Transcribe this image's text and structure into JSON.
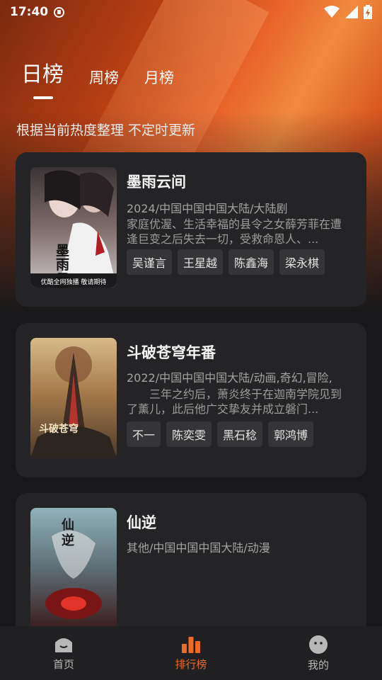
{
  "status_bar": {
    "time": "17:40"
  },
  "tabs": [
    {
      "label": "日榜",
      "active": true
    },
    {
      "label": "周榜",
      "active": false
    },
    {
      "label": "月榜",
      "active": false
    }
  ],
  "subtitle": "根据当前热度整理 不定时更新",
  "items": [
    {
      "title": "墨雨云间",
      "meta": "2024/中国中国中国大陆/大陆剧",
      "description": "家庭优渥、生活幸福的县令之女薛芳菲在遭逢巨变之后失去一切，受救命恩人、...",
      "cast": [
        "吴谨言",
        "王星越",
        "陈鑫海",
        "梁永棋"
      ],
      "poster_text": "墨雨云间",
      "poster_caption": "优酷全网独播 敬请期待"
    },
    {
      "title": "斗破苍穹年番",
      "meta": "2022/中国中国中国大陆/动画,奇幻,冒险,",
      "description": "　　三年之约后，萧炎终于在迦南学院见到了薰儿，此后他广交挚友并成立磐门...",
      "cast": [
        "不一",
        "陈奕雯",
        "黑石稔",
        "郭鸿博"
      ],
      "poster_text": "斗破苍穹"
    },
    {
      "title": "仙逆",
      "meta": "其他/中国中国中国大陆/动漫",
      "poster_text": "仙逆"
    }
  ],
  "bottom_nav": [
    {
      "label": "首页",
      "icon": "home-icon",
      "active": false
    },
    {
      "label": "排行榜",
      "icon": "ranking-icon",
      "active": true
    },
    {
      "label": "我的",
      "icon": "profile-icon",
      "active": false
    }
  ],
  "colors": {
    "accent": "#ee6a25",
    "card": "#242426",
    "background": "#18181a"
  }
}
